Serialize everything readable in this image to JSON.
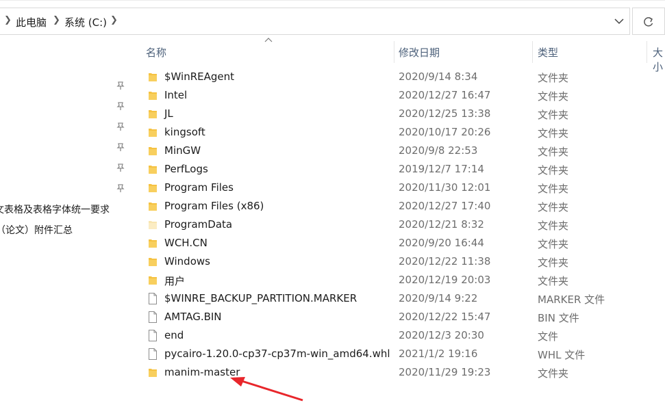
{
  "breadcrumb": {
    "items": [
      "此电脑",
      "系统 (C:)"
    ]
  },
  "nav": {
    "items": [
      "文表格及表格字体统一要求",
      "（论文）附件汇总"
    ]
  },
  "columns": {
    "name": "名称",
    "date": "修改日期",
    "type": "类型",
    "size": "大小"
  },
  "files": [
    {
      "name": "$WinREAgent",
      "date": "2020/9/14 8:34",
      "type": "文件夹",
      "icon": "folder-icon"
    },
    {
      "name": "Intel",
      "date": "2020/12/27 16:47",
      "type": "文件夹",
      "icon": "folder-icon"
    },
    {
      "name": "JL",
      "date": "2020/12/25 13:38",
      "type": "文件夹",
      "icon": "folder-icon"
    },
    {
      "name": "kingsoft",
      "date": "2020/10/17 20:26",
      "type": "文件夹",
      "icon": "folder-icon"
    },
    {
      "name": "MinGW",
      "date": "2020/9/8 22:53",
      "type": "文件夹",
      "icon": "folder-icon"
    },
    {
      "name": "PerfLogs",
      "date": "2019/12/7 17:14",
      "type": "文件夹",
      "icon": "folder-icon"
    },
    {
      "name": "Program Files",
      "date": "2020/11/30 12:01",
      "type": "文件夹",
      "icon": "folder-icon"
    },
    {
      "name": "Program Files (x86)",
      "date": "2020/12/27 17:40",
      "type": "文件夹",
      "icon": "folder-icon"
    },
    {
      "name": "ProgramData",
      "date": "2020/12/21 8:32",
      "type": "文件夹",
      "icon": "hidden-folder-icon"
    },
    {
      "name": "WCH.CN",
      "date": "2020/9/20 16:44",
      "type": "文件夹",
      "icon": "folder-icon"
    },
    {
      "name": "Windows",
      "date": "2020/12/22 11:38",
      "type": "文件夹",
      "icon": "folder-icon"
    },
    {
      "name": "用户",
      "date": "2020/12/19 20:03",
      "type": "文件夹",
      "icon": "folder-icon"
    },
    {
      "name": "$WINRE_BACKUP_PARTITION.MARKER",
      "date": "2020/9/14 9:22",
      "type": "MARKER 文件",
      "icon": "file-icon"
    },
    {
      "name": "AMTAG.BIN",
      "date": "2020/12/22 15:47",
      "type": "BIN 文件",
      "icon": "file-icon"
    },
    {
      "name": "end",
      "date": "2020/12/3 20:30",
      "type": "文件",
      "icon": "file-icon"
    },
    {
      "name": "pycairo-1.20.0-cp37-cp37m-win_amd64.whl",
      "date": "2021/1/2 19:16",
      "type": "WHL 文件",
      "icon": "file-icon"
    },
    {
      "name": "manim-master",
      "date": "2020/11/29 19:23",
      "type": "文件夹",
      "icon": "folder-icon"
    }
  ],
  "icons": {
    "folder": "folder-icon",
    "hidden_folder": "hidden-folder-icon",
    "file": "file-icon",
    "pin": "pin-icon",
    "refresh": "refresh-icon",
    "chevron_down": "chevron-down-icon",
    "chevron_right": "chevron-right-icon",
    "annotation_arrow": "red-arrow-annotation"
  },
  "colors": {
    "folder": "#f5c242",
    "hidden_folder": "#f8e5b0",
    "annotation": "#e8262b",
    "header_text": "#4c607a",
    "meta_text": "#6d6d6d"
  }
}
